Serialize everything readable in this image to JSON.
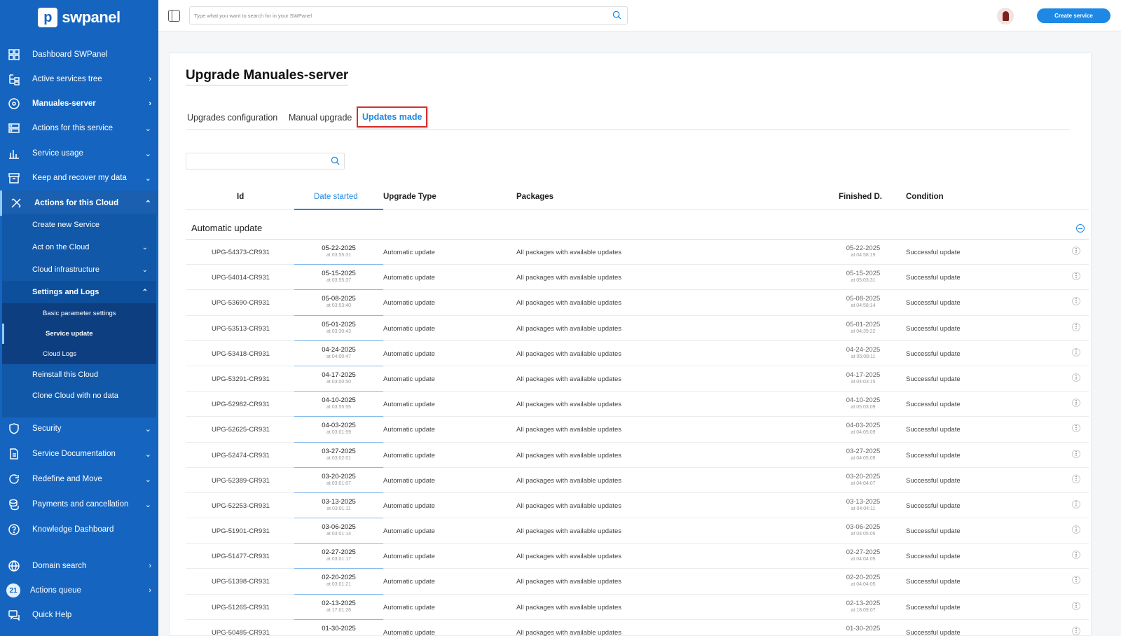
{
  "brand": {
    "name": "swpanel"
  },
  "sidebar": {
    "items": [
      {
        "label": "Dashboard SWPanel",
        "icon": "grid-icon",
        "chevron": ""
      },
      {
        "label": "Active services tree",
        "icon": "tree-icon",
        "chevron": "›"
      },
      {
        "label": "Manuales-server",
        "icon": "disc-icon",
        "chevron": "›"
      },
      {
        "label": "Actions for this service",
        "icon": "server-icon",
        "chevron": "⌄"
      },
      {
        "label": "Service usage",
        "icon": "chart-icon",
        "chevron": "⌄"
      },
      {
        "label": "Keep and recover my data",
        "icon": "archive-icon",
        "chevron": "⌄"
      },
      {
        "label": "Actions for this Cloud",
        "icon": "tools-icon",
        "chevron": "⌃"
      }
    ],
    "cloud_sub": [
      {
        "label": "Create new Service",
        "chevron": ""
      },
      {
        "label": "Act on the Cloud",
        "chevron": "⌄"
      },
      {
        "label": "Cloud infrastructure",
        "chevron": "⌄"
      },
      {
        "label": "Settings and Logs",
        "chevron": "⌃"
      }
    ],
    "settings_sub": [
      {
        "label": "Basic parameter settings"
      },
      {
        "label": "Service update"
      },
      {
        "label": "Cloud Logs"
      }
    ],
    "cloud_sub_tail": [
      {
        "label": "Reinstall this Cloud"
      },
      {
        "label": "Clone Cloud with no data"
      }
    ],
    "items_bottom": [
      {
        "label": "Security",
        "icon": "shield-icon",
        "chevron": "⌄"
      },
      {
        "label": "Service Documentation",
        "icon": "document-icon",
        "chevron": "⌄"
      },
      {
        "label": "Redefine and Move",
        "icon": "refresh-icon",
        "chevron": "⌄"
      },
      {
        "label": "Payments and cancellation",
        "icon": "coins-icon",
        "chevron": "⌄"
      },
      {
        "label": "Knowledge Dashboard",
        "icon": "help-circle-icon",
        "chevron": ""
      }
    ],
    "items_footer": [
      {
        "label": "Domain search",
        "icon": "globe-icon",
        "chevron": "›"
      },
      {
        "label": "Actions queue",
        "badge": "21",
        "chevron": "›"
      },
      {
        "label": "Quick Help",
        "icon": "chat-icon",
        "chevron": ""
      }
    ]
  },
  "topbar": {
    "search_placeholder": "Type what you want to search for in your SWPanel",
    "create_label": "Create service"
  },
  "page": {
    "title": "Upgrade Manuales-server",
    "tabs": [
      "Upgrades configuration",
      "Manual upgrade",
      "Updates made"
    ],
    "active_tab": "Updates made"
  },
  "table": {
    "headers": {
      "id": "Id",
      "date_started": "Date started",
      "upgrade_type": "Upgrade Type",
      "packages": "Packages",
      "finished": "Finished D.",
      "condition": "Condition"
    },
    "group_label": "Automatic update",
    "rows": [
      {
        "id": "UPG-54373-CR931",
        "date": "05-22-2025",
        "time": "at 03:55:31",
        "type": "Automatic update",
        "packages": "All packages with available updates",
        "fdate": "05-22-2025",
        "ftime": "at 04:58:19",
        "condition": "Successful update"
      },
      {
        "id": "UPG-54014-CR931",
        "date": "05-15-2025",
        "time": "at 03:55:37",
        "type": "Automatic update",
        "packages": "All packages with available updates",
        "fdate": "05-15-2025",
        "ftime": "at 05:03:31",
        "condition": "Successful update"
      },
      {
        "id": "UPG-53690-CR931",
        "date": "05-08-2025",
        "time": "at 03:53:40",
        "type": "Automatic update",
        "packages": "All packages with available updates",
        "fdate": "05-08-2025",
        "ftime": "at 04:58:14",
        "condition": "Successful update"
      },
      {
        "id": "UPG-53513-CR931",
        "date": "05-01-2025",
        "time": "at 03:30:43",
        "type": "Automatic update",
        "packages": "All packages with available updates",
        "fdate": "05-01-2025",
        "ftime": "at 04:39:22",
        "condition": "Successful update"
      },
      {
        "id": "UPG-53418-CR931",
        "date": "04-24-2025",
        "time": "at 04:00:47",
        "type": "Automatic update",
        "packages": "All packages with available updates",
        "fdate": "04-24-2025",
        "ftime": "at 05:08:11",
        "condition": "Successful update"
      },
      {
        "id": "UPG-53291-CR931",
        "date": "04-17-2025",
        "time": "at 03:00:50",
        "type": "Automatic update",
        "packages": "All packages with available updates",
        "fdate": "04-17-2025",
        "ftime": "at 04:03:15",
        "condition": "Successful update"
      },
      {
        "id": "UPG-52982-CR931",
        "date": "04-10-2025",
        "time": "at 03:55:55",
        "type": "Automatic update",
        "packages": "All packages with available updates",
        "fdate": "04-10-2025",
        "ftime": "at 05:03:09",
        "condition": "Successful update"
      },
      {
        "id": "UPG-52625-CR931",
        "date": "04-03-2025",
        "time": "at 03:01:59",
        "type": "Automatic update",
        "packages": "All packages with available updates",
        "fdate": "04-03-2025",
        "ftime": "at 04:05:09",
        "condition": "Successful update"
      },
      {
        "id": "UPG-52474-CR931",
        "date": "03-27-2025",
        "time": "at 03:02:01",
        "type": "Automatic update",
        "packages": "All packages with available updates",
        "fdate": "03-27-2025",
        "ftime": "at 04:05:09",
        "condition": "Successful update"
      },
      {
        "id": "UPG-52389-CR931",
        "date": "03-20-2025",
        "time": "at 03:01:07",
        "type": "Automatic update",
        "packages": "All packages with available updates",
        "fdate": "03-20-2025",
        "ftime": "at 04:04:07",
        "condition": "Successful update"
      },
      {
        "id": "UPG-52253-CR931",
        "date": "03-13-2025",
        "time": "at 03:01:11",
        "type": "Automatic update",
        "packages": "All packages with available updates",
        "fdate": "03-13-2025",
        "ftime": "at 04:04:11",
        "condition": "Successful update"
      },
      {
        "id": "UPG-51901-CR931",
        "date": "03-06-2025",
        "time": "at 03:01:14",
        "type": "Automatic update",
        "packages": "All packages with available updates",
        "fdate": "03-06-2025",
        "ftime": "at 04:05:05",
        "condition": "Successful update"
      },
      {
        "id": "UPG-51477-CR931",
        "date": "02-27-2025",
        "time": "at 03:01:17",
        "type": "Automatic update",
        "packages": "All packages with available updates",
        "fdate": "02-27-2025",
        "ftime": "at 04:04:05",
        "condition": "Successful update"
      },
      {
        "id": "UPG-51398-CR931",
        "date": "02-20-2025",
        "time": "at 03:01:21",
        "type": "Automatic update",
        "packages": "All packages with available updates",
        "fdate": "02-20-2025",
        "ftime": "at 04:04:05",
        "condition": "Successful update"
      },
      {
        "id": "UPG-51265-CR931",
        "date": "02-13-2025",
        "time": "at 17:01:26",
        "type": "Automatic update",
        "packages": "All packages with available updates",
        "fdate": "02-13-2025",
        "ftime": "at 18:09:07",
        "condition": "Successful update"
      },
      {
        "id": "UPG-50485-CR931",
        "date": "01-30-2025",
        "time": "",
        "type": "Automatic update",
        "packages": "All packages with available updates",
        "fdate": "01-30-2025",
        "ftime": "",
        "condition": "Successful update"
      }
    ]
  },
  "colors": {
    "sidebar": "#1565c0",
    "accent": "#1e88e5",
    "highlight": "#d32f2f"
  }
}
